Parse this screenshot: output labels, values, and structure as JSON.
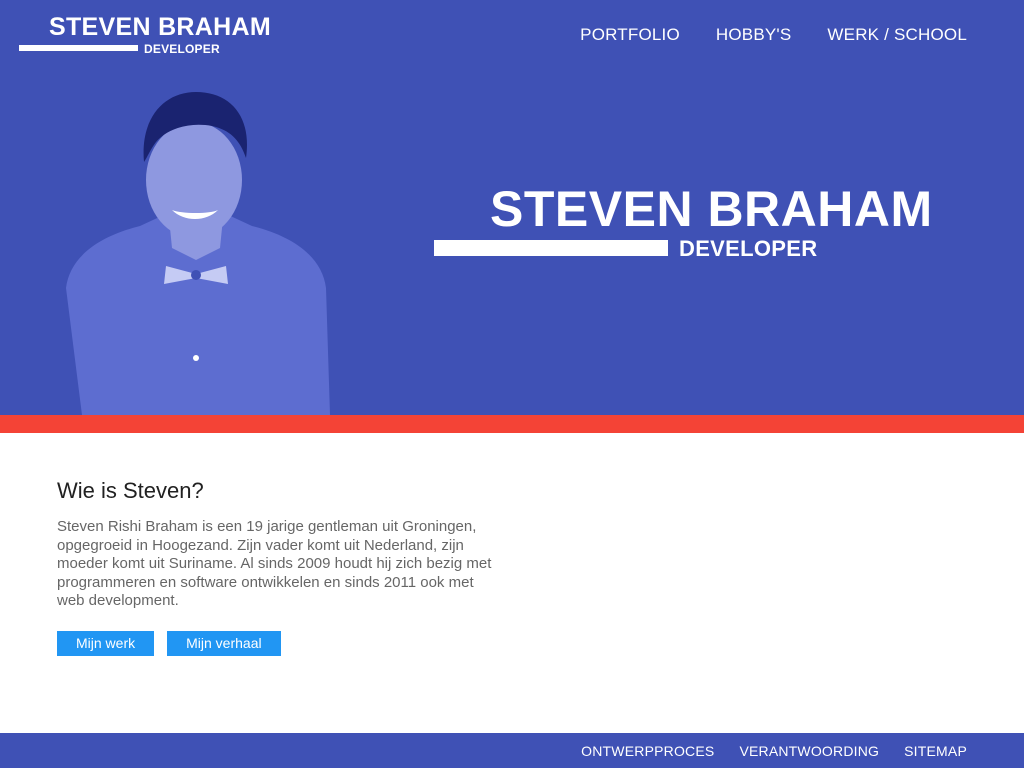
{
  "header": {
    "logo_name": "STEVEN BRAHAM",
    "logo_role": "DEVELOPER",
    "nav": [
      "PORTFOLIO",
      "HOBBY'S",
      "WERK / SCHOOL"
    ]
  },
  "hero": {
    "name": "STEVEN BRAHAM",
    "role": "DEVELOPER"
  },
  "about": {
    "title": "Wie is Steven?",
    "text": "Steven Rishi Braham is een 19 jarige gentleman uit Groningen, opgegroeid in Hoogezand. Zijn vader komt uit Nederland, zijn moeder komt uit Suriname.  Al sinds 2009 houdt hij zich bezig met programmeren en software ontwikkelen en sinds 2011 ook met web development.",
    "buttons": [
      "Mijn werk",
      "Mijn verhaal"
    ]
  },
  "footer": {
    "links": [
      "ONTWERPPROCES",
      "VERANTWOORDING",
      "SITEMAP"
    ]
  },
  "colors": {
    "primary": "#3f51b5",
    "accent_stripe": "#f44336",
    "button": "#2196f3"
  }
}
